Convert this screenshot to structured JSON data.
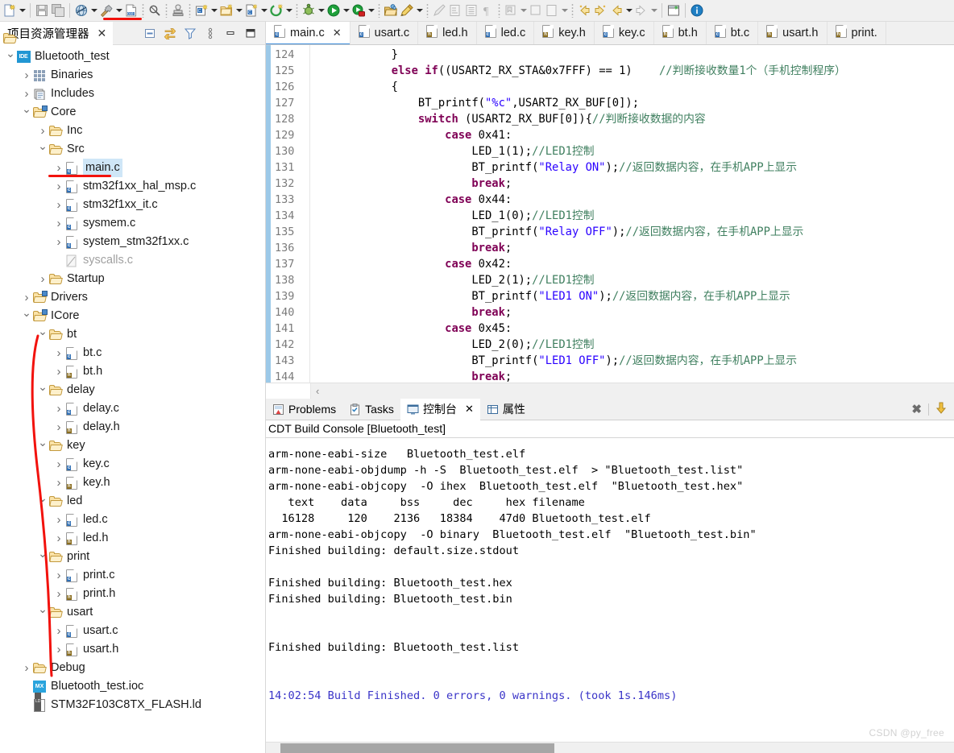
{
  "toolbar": {
    "items": [
      {
        "name": "new-file-icon",
        "glyph": "new",
        "arrow": true
      },
      {
        "sep": true
      },
      {
        "name": "save-icon",
        "glyph": "save",
        "arrow": false
      },
      {
        "name": "save-all-icon",
        "glyph": "saveall",
        "arrow": false
      },
      {
        "sep": true
      },
      {
        "name": "build-all-icon",
        "glyph": "globe",
        "arrow": true
      },
      {
        "name": "build-hammer-icon",
        "glyph": "hammer",
        "arrow": true,
        "highlight": true
      },
      {
        "name": "binary-file-icon",
        "glyph": "bin010",
        "arrow": false
      },
      {
        "dots": true
      },
      {
        "name": "search-icon",
        "glyph": "search",
        "arrow": false
      },
      {
        "dots": true
      },
      {
        "name": "link-icon",
        "glyph": "stamp",
        "arrow": false
      },
      {
        "dots": true
      },
      {
        "name": "new-c-project-icon",
        "glyph": "cproj",
        "arrow": true
      },
      {
        "name": "new-folder-icon",
        "glyph": "newfolder",
        "arrow": true
      },
      {
        "name": "new-c-file-icon",
        "glyph": "cfile",
        "arrow": true
      },
      {
        "name": "new-source-icon",
        "glyph": "greenc",
        "arrow": true
      },
      {
        "dots": true
      },
      {
        "name": "debug-icon",
        "glyph": "bug",
        "arrow": true
      },
      {
        "name": "run-icon",
        "glyph": "run",
        "arrow": true
      },
      {
        "name": "profile-icon",
        "glyph": "profile",
        "arrow": true
      },
      {
        "dots": true
      },
      {
        "name": "open-resource-icon",
        "glyph": "openres",
        "arrow": false
      },
      {
        "name": "pencil-icon",
        "glyph": "pencil",
        "arrow": true
      },
      {
        "dots": true
      },
      {
        "name": "brush-icon",
        "glyph": "brush",
        "arrow": false,
        "disabled": true
      },
      {
        "name": "export-icon",
        "glyph": "export",
        "arrow": false,
        "disabled": true
      },
      {
        "name": "list-icon",
        "glyph": "list",
        "arrow": false,
        "disabled": true
      },
      {
        "name": "pilcrow-icon",
        "glyph": "pilcrow",
        "arrow": false,
        "disabled": true
      },
      {
        "dots": true
      },
      {
        "name": "bookmark-icon",
        "glyph": "bookmark",
        "arrow": true,
        "disabled": true
      },
      {
        "name": "annotate-icon",
        "glyph": "annotate",
        "arrow": false,
        "disabled": true
      },
      {
        "name": "page-icon",
        "glyph": "page",
        "arrow": true,
        "disabled": true
      },
      {
        "dots": true
      },
      {
        "name": "back-icon",
        "glyph": "arrow-left-star",
        "arrow": false
      },
      {
        "name": "forward-icon",
        "glyph": "arrow-right-star",
        "arrow": false
      },
      {
        "name": "prev-icon",
        "glyph": "arrow-left",
        "arrow": true
      },
      {
        "name": "next-icon",
        "glyph": "arrow-right",
        "arrow": true,
        "disabled": true
      },
      {
        "sep": true
      },
      {
        "name": "perspective-icon",
        "glyph": "perspective",
        "arrow": false
      },
      {
        "sep": true
      },
      {
        "name": "info-icon",
        "glyph": "info",
        "arrow": false
      }
    ]
  },
  "project_explorer": {
    "tab_label": "项目资源管理器",
    "close_label": "✕",
    "tools": [
      {
        "name": "collapse-all-icon"
      },
      {
        "name": "link-with-editor-icon"
      },
      {
        "name": "filter-icon"
      },
      {
        "name": "view-menu-icon"
      },
      {
        "name": "minimize-icon"
      },
      {
        "name": "maximize-icon"
      }
    ],
    "tree": [
      {
        "label": "Bluetooth_test",
        "indent": 0,
        "twisty": "v",
        "icon": "ide",
        "selected": false
      },
      {
        "label": "Binaries",
        "indent": 1,
        "twisty": ">",
        "icon": "bin",
        "selected": false
      },
      {
        "label": "Includes",
        "indent": 1,
        "twisty": ">",
        "icon": "incl",
        "selected": false
      },
      {
        "label": "Core",
        "indent": 1,
        "twisty": "v",
        "icon": "pkg",
        "selected": false
      },
      {
        "label": "Inc",
        "indent": 2,
        "twisty": ">",
        "icon": "folder",
        "selected": false
      },
      {
        "label": "Src",
        "indent": 2,
        "twisty": "v",
        "icon": "folder",
        "selected": false
      },
      {
        "label": "main.c",
        "indent": 3,
        "twisty": ">",
        "icon": "c",
        "selected": true
      },
      {
        "label": "stm32f1xx_hal_msp.c",
        "indent": 3,
        "twisty": ">",
        "icon": "c",
        "selected": false
      },
      {
        "label": "stm32f1xx_it.c",
        "indent": 3,
        "twisty": ">",
        "icon": "c",
        "selected": false
      },
      {
        "label": "sysmem.c",
        "indent": 3,
        "twisty": ">",
        "icon": "c",
        "selected": false
      },
      {
        "label": "system_stm32f1xx.c",
        "indent": 3,
        "twisty": ">",
        "icon": "c",
        "selected": false
      },
      {
        "label": "syscalls.c",
        "indent": 3,
        "twisty": "",
        "icon": "cdim",
        "selected": false,
        "dim": true
      },
      {
        "label": "Startup",
        "indent": 2,
        "twisty": ">",
        "icon": "folder",
        "selected": false
      },
      {
        "label": "Drivers",
        "indent": 1,
        "twisty": ">",
        "icon": "pkg",
        "selected": false
      },
      {
        "label": "ICore",
        "indent": 1,
        "twisty": "v",
        "icon": "pkg",
        "selected": false
      },
      {
        "label": "bt",
        "indent": 2,
        "twisty": "v",
        "icon": "folder",
        "selected": false
      },
      {
        "label": "bt.c",
        "indent": 3,
        "twisty": ">",
        "icon": "c",
        "selected": false
      },
      {
        "label": "bt.h",
        "indent": 3,
        "twisty": ">",
        "icon": "h",
        "selected": false
      },
      {
        "label": "delay",
        "indent": 2,
        "twisty": "v",
        "icon": "folder",
        "selected": false
      },
      {
        "label": "delay.c",
        "indent": 3,
        "twisty": ">",
        "icon": "c",
        "selected": false
      },
      {
        "label": "delay.h",
        "indent": 3,
        "twisty": ">",
        "icon": "h",
        "selected": false
      },
      {
        "label": "key",
        "indent": 2,
        "twisty": "v",
        "icon": "folder",
        "selected": false
      },
      {
        "label": "key.c",
        "indent": 3,
        "twisty": ">",
        "icon": "c",
        "selected": false
      },
      {
        "label": "key.h",
        "indent": 3,
        "twisty": ">",
        "icon": "h",
        "selected": false
      },
      {
        "label": "led",
        "indent": 2,
        "twisty": "v",
        "icon": "folder",
        "selected": false
      },
      {
        "label": "led.c",
        "indent": 3,
        "twisty": ">",
        "icon": "c",
        "selected": false
      },
      {
        "label": "led.h",
        "indent": 3,
        "twisty": ">",
        "icon": "h",
        "selected": false
      },
      {
        "label": "print",
        "indent": 2,
        "twisty": "v",
        "icon": "folder",
        "selected": false
      },
      {
        "label": "print.c",
        "indent": 3,
        "twisty": ">",
        "icon": "c",
        "selected": false
      },
      {
        "label": "print.h",
        "indent": 3,
        "twisty": ">",
        "icon": "h",
        "selected": false
      },
      {
        "label": "usart",
        "indent": 2,
        "twisty": "v",
        "icon": "folder",
        "selected": false
      },
      {
        "label": "usart.c",
        "indent": 3,
        "twisty": ">",
        "icon": "c",
        "selected": false
      },
      {
        "label": "usart.h",
        "indent": 3,
        "twisty": ">",
        "icon": "h",
        "selected": false
      },
      {
        "label": "Debug",
        "indent": 1,
        "twisty": ">",
        "icon": "folder",
        "selected": false
      },
      {
        "label": "Bluetooth_test.ioc",
        "indent": 1,
        "twisty": "",
        "icon": "mx",
        "selected": false
      },
      {
        "label": "STM32F103C8TX_FLASH.ld",
        "indent": 1,
        "twisty": "",
        "icon": "ld",
        "selected": false
      }
    ],
    "annotation_color": "#f2120d"
  },
  "editor": {
    "tabs": [
      {
        "label": "main.c",
        "icon": "c",
        "active": true,
        "closable": true
      },
      {
        "label": "usart.c",
        "icon": "c",
        "active": false,
        "closable": false
      },
      {
        "label": "led.h",
        "icon": "h",
        "active": false,
        "closable": false
      },
      {
        "label": "led.c",
        "icon": "c",
        "active": false,
        "closable": false
      },
      {
        "label": "key.h",
        "icon": "h",
        "active": false,
        "closable": false
      },
      {
        "label": "key.c",
        "icon": "c",
        "active": false,
        "closable": false
      },
      {
        "label": "bt.h",
        "icon": "h",
        "active": false,
        "closable": false
      },
      {
        "label": "bt.c",
        "icon": "c",
        "active": false,
        "closable": false
      },
      {
        "label": "usart.h",
        "icon": "h",
        "active": false,
        "closable": false
      },
      {
        "label": "print.",
        "icon": "h",
        "active": false,
        "closable": false
      }
    ],
    "first_line_number": 124,
    "line_numbers": [
      124,
      125,
      126,
      127,
      128,
      129,
      130,
      131,
      132,
      133,
      134,
      135,
      136,
      137,
      138,
      139,
      140,
      141,
      142,
      143,
      144
    ],
    "lines": [
      [
        {
          "t": "            }",
          "c": "plain"
        }
      ],
      [
        {
          "t": "            ",
          "c": "plain"
        },
        {
          "t": "else if",
          "c": "kw"
        },
        {
          "t": "((USART2_RX_STA&0x7FFF) == 1)    ",
          "c": "plain"
        },
        {
          "t": "//判断接收数量1个（手机控制程序）",
          "c": "cmt"
        }
      ],
      [
        {
          "t": "            {",
          "c": "plain"
        }
      ],
      [
        {
          "t": "                BT_printf(",
          "c": "plain"
        },
        {
          "t": "\"%c\"",
          "c": "str"
        },
        {
          "t": ",USART2_RX_BUF[0]);",
          "c": "plain"
        }
      ],
      [
        {
          "t": "                ",
          "c": "plain"
        },
        {
          "t": "switch",
          "c": "kw"
        },
        {
          "t": " (USART2_RX_BUF[0]){",
          "c": "plain"
        },
        {
          "t": "//判断接收数据的内容",
          "c": "cmt"
        }
      ],
      [
        {
          "t": "                    ",
          "c": "plain"
        },
        {
          "t": "case",
          "c": "kw"
        },
        {
          "t": " 0x41:",
          "c": "plain"
        }
      ],
      [
        {
          "t": "                        LED_1(1);",
          "c": "plain"
        },
        {
          "t": "//LED1控制",
          "c": "cmt"
        }
      ],
      [
        {
          "t": "                        BT_printf(",
          "c": "plain"
        },
        {
          "t": "\"Relay ON\"",
          "c": "str"
        },
        {
          "t": ");",
          "c": "plain"
        },
        {
          "t": "//返回数据内容，在手机APP上显示",
          "c": "cmt"
        }
      ],
      [
        {
          "t": "                        ",
          "c": "plain"
        },
        {
          "t": "break",
          "c": "kw"
        },
        {
          "t": ";",
          "c": "plain"
        }
      ],
      [
        {
          "t": "                    ",
          "c": "plain"
        },
        {
          "t": "case",
          "c": "kw"
        },
        {
          "t": " 0x44:",
          "c": "plain"
        }
      ],
      [
        {
          "t": "                        LED_1(0);",
          "c": "plain"
        },
        {
          "t": "//LED1控制",
          "c": "cmt"
        }
      ],
      [
        {
          "t": "                        BT_printf(",
          "c": "plain"
        },
        {
          "t": "\"Relay OFF\"",
          "c": "str"
        },
        {
          "t": ");",
          "c": "plain"
        },
        {
          "t": "//返回数据内容，在手机APP上显示",
          "c": "cmt"
        }
      ],
      [
        {
          "t": "                        ",
          "c": "plain"
        },
        {
          "t": "break",
          "c": "kw"
        },
        {
          "t": ";",
          "c": "plain"
        }
      ],
      [
        {
          "t": "                    ",
          "c": "plain"
        },
        {
          "t": "case",
          "c": "kw"
        },
        {
          "t": " 0x42:",
          "c": "plain"
        }
      ],
      [
        {
          "t": "                        LED_2(1);",
          "c": "plain"
        },
        {
          "t": "//LED1控制",
          "c": "cmt"
        }
      ],
      [
        {
          "t": "                        BT_printf(",
          "c": "plain"
        },
        {
          "t": "\"LED1 ON\"",
          "c": "str"
        },
        {
          "t": ");",
          "c": "plain"
        },
        {
          "t": "//返回数据内容，在手机APP上显示",
          "c": "cmt"
        }
      ],
      [
        {
          "t": "                        ",
          "c": "plain"
        },
        {
          "t": "break",
          "c": "kw"
        },
        {
          "t": ";",
          "c": "plain"
        }
      ],
      [
        {
          "t": "                    ",
          "c": "plain"
        },
        {
          "t": "case",
          "c": "kw"
        },
        {
          "t": " 0x45:",
          "c": "plain"
        }
      ],
      [
        {
          "t": "                        LED_2(0);",
          "c": "plain"
        },
        {
          "t": "//LED1控制",
          "c": "cmt"
        }
      ],
      [
        {
          "t": "                        BT_printf(",
          "c": "plain"
        },
        {
          "t": "\"LED1 OFF\"",
          "c": "str"
        },
        {
          "t": ");",
          "c": "plain"
        },
        {
          "t": "//返回数据内容，在手机APP上显示",
          "c": "cmt"
        }
      ],
      [
        {
          "t": "                        ",
          "c": "plain"
        },
        {
          "t": "break",
          "c": "kw"
        },
        {
          "t": ";",
          "c": "plain"
        }
      ]
    ]
  },
  "console_panel": {
    "tabs": [
      {
        "label": "Problems",
        "icon": "problems-icon",
        "active": false,
        "closable": false
      },
      {
        "label": "Tasks",
        "icon": "tasks-icon",
        "active": false,
        "closable": false
      },
      {
        "label": "控制台",
        "icon": "console-icon",
        "active": true,
        "closable": true
      },
      {
        "label": "属性",
        "icon": "properties-icon",
        "active": false,
        "closable": false
      }
    ],
    "close_label": "✕",
    "tools": [
      {
        "name": "clear-console-button",
        "glyph": "✖"
      },
      {
        "name": "scroll-lock-button",
        "glyph": "⬇"
      }
    ],
    "title": "CDT Build Console [Bluetooth_test]",
    "output": [
      {
        "text": "arm-none-eabi-size   Bluetooth_test.elf",
        "style": "plain"
      },
      {
        "text": "arm-none-eabi-objdump -h -S  Bluetooth_test.elf  > \"Bluetooth_test.list\"",
        "style": "plain"
      },
      {
        "text": "arm-none-eabi-objcopy  -O ihex  Bluetooth_test.elf  \"Bluetooth_test.hex\"",
        "style": "plain"
      },
      {
        "text": "   text    data     bss     dec     hex filename",
        "style": "plain"
      },
      {
        "text": "  16128     120    2136   18384    47d0 Bluetooth_test.elf",
        "style": "plain"
      },
      {
        "text": "arm-none-eabi-objcopy  -O binary  Bluetooth_test.elf  \"Bluetooth_test.bin\"",
        "style": "plain"
      },
      {
        "text": "Finished building: default.size.stdout",
        "style": "plain"
      },
      {
        "text": " ",
        "style": "plain"
      },
      {
        "text": "Finished building: Bluetooth_test.hex",
        "style": "plain"
      },
      {
        "text": "Finished building: Bluetooth_test.bin",
        "style": "plain"
      },
      {
        "text": " ",
        "style": "plain"
      },
      {
        "text": " ",
        "style": "plain"
      },
      {
        "text": "Finished building: Bluetooth_test.list",
        "style": "plain"
      },
      {
        "text": " ",
        "style": "plain"
      },
      {
        "text": " ",
        "style": "plain"
      },
      {
        "text": "14:02:54 Build Finished. 0 errors, 0 warnings. (took 1s.146ms)",
        "style": "blue"
      }
    ]
  },
  "watermark": "CSDN @py_free",
  "colors": {
    "accent": "#3b8ad9",
    "annotation": "#f2120d",
    "keyword": "#7f0055",
    "string": "#2a00ff",
    "comment": "#3f7f5f",
    "console_blue": "#3a34c8",
    "selection": "#cfe6f7"
  }
}
